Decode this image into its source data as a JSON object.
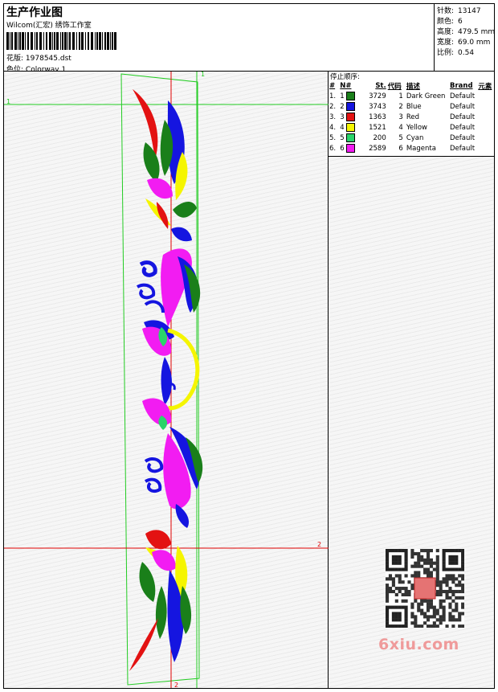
{
  "header": {
    "title": "生产作业图",
    "company": "Wilcom(汇宏) 绣饰工作室",
    "design_label": "花版:",
    "design_value": "1978545.dst",
    "colorway_label": "色位:",
    "colorway_value": "Colorway 1"
  },
  "stats": [
    {
      "label": "针数:",
      "value": "13147"
    },
    {
      "label": "颜色:",
      "value": "6"
    },
    {
      "label": "高度:",
      "value": "479.5 mm"
    },
    {
      "label": "宽度:",
      "value": "69.0 mm"
    },
    {
      "label": "比例:",
      "value": "0.54"
    }
  ],
  "stop_sequence": {
    "caption": "停止顺序:",
    "columns": [
      "#",
      "N#",
      "St.",
      "代码",
      "描述",
      "Brand",
      "元素"
    ],
    "rows": [
      {
        "idx": "1.",
        "n": "1",
        "color": "#1a7f1a",
        "st": "3729",
        "code": "1",
        "desc": "Dark Green",
        "brand": "Default"
      },
      {
        "idx": "2.",
        "n": "2",
        "color": "#1515e0",
        "st": "3743",
        "code": "2",
        "desc": "Blue",
        "brand": "Default"
      },
      {
        "idx": "3.",
        "n": "3",
        "color": "#e31212",
        "st": "1363",
        "code": "3",
        "desc": "Red",
        "brand": "Default"
      },
      {
        "idx": "4.",
        "n": "4",
        "color": "#f5f500",
        "st": "1521",
        "code": "4",
        "desc": "Yellow",
        "brand": "Default"
      },
      {
        "idx": "5.",
        "n": "5",
        "color": "#2ad46a",
        "st": "200",
        "code": "5",
        "desc": "Cyan",
        "brand": "Default"
      },
      {
        "idx": "6.",
        "n": "6",
        "color": "#f21cf2",
        "st": "2589",
        "code": "6",
        "desc": "Magenta",
        "brand": "Default"
      }
    ]
  },
  "guides": {
    "green_h_label": "1",
    "green_v_label": "1",
    "red_h_label": "2",
    "red_v_label": "2"
  },
  "colors": {
    "dark_green": "#1a7f1a",
    "blue": "#1515e0",
    "red": "#e31212",
    "yellow": "#f5f500",
    "cyan": "#2ad46a",
    "magenta": "#f21cf2",
    "guide_green": "#22cc22",
    "guide_red": "#e00000",
    "watermark": "#ef9a9a"
  },
  "watermark": {
    "text": "6xiu.com",
    "qr_icon": "qr-code-icon"
  }
}
